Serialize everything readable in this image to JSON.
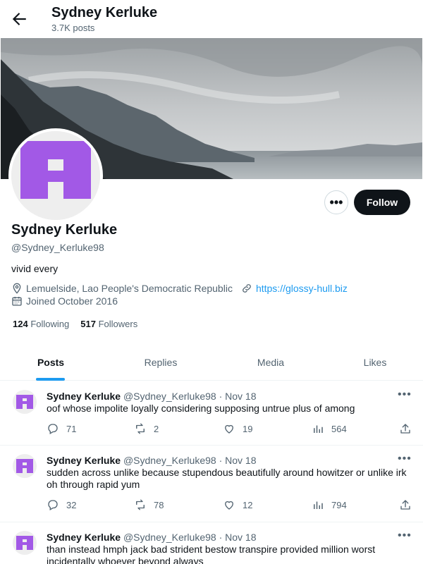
{
  "header": {
    "name": "Sydney Kerluke",
    "post_count": "3.7K posts"
  },
  "profile": {
    "name": "Sydney Kerluke",
    "handle": "@Sydney_Kerluke98",
    "bio": "vivid every",
    "location": "Lemuelside, Lao People's Democratic Republic",
    "website": "https://glossy-hull.biz",
    "joined": "Joined October 2016",
    "following_count": "124",
    "following_label": "Following",
    "followers_count": "517",
    "followers_label": "Followers",
    "follow_button": "Follow",
    "more_button": "•••",
    "avatar_color": "#a259e6"
  },
  "tabs": [
    {
      "label": "Posts",
      "active": true
    },
    {
      "label": "Replies",
      "active": false
    },
    {
      "label": "Media",
      "active": false
    },
    {
      "label": "Likes",
      "active": false
    }
  ],
  "posts": [
    {
      "name": "Sydney Kerluke",
      "handle": "@Sydney_Kerluke98",
      "date": "· Nov 18",
      "text": "oof whose impolite loyally considering supposing untrue plus of among",
      "replies": "71",
      "reposts": "2",
      "likes": "19",
      "views": "564"
    },
    {
      "name": "Sydney Kerluke",
      "handle": "@Sydney_Kerluke98",
      "date": "· Nov 18",
      "text": "sudden across unlike because stupendous beautifully around howitzer or unlike irk oh through rapid yum",
      "replies": "32",
      "reposts": "78",
      "likes": "12",
      "views": "794"
    },
    {
      "name": "Sydney Kerluke",
      "handle": "@Sydney_Kerluke98",
      "date": "· Nov 18",
      "text": "than instead hmph jack bad strident bestow transpire provided million worst incidentally whoever beyond always",
      "replies": "",
      "reposts": "",
      "likes": "",
      "views": ""
    }
  ],
  "colors": {
    "accent": "#1d9bf0",
    "text_primary": "#0f1419",
    "text_secondary": "#536471"
  }
}
